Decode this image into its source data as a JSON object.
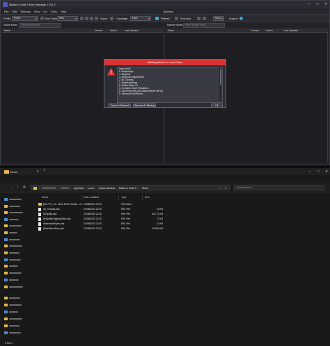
{
  "mod_manager": {
    "title": "Baldur's Gate 3 Mod Manager 1.0.6.4",
    "menu": [
      "File",
      "Edit",
      "Settings",
      "View",
      "Go",
      "Tools",
      "Help"
    ],
    "updates_label": "Updates",
    "toolbar": {
      "profile_label": "Profile",
      "profile_value": "Public",
      "modorder_label": "Mod Order",
      "modorder_value": "New",
      "export_label": "Export",
      "campaign_label": "Campaign",
      "campaign_value": "Main",
      "refresh_label": "Refresh",
      "shortcuts_label": "Shortcuts",
      "none_value": "None",
      "support_label": "Support"
    },
    "active_mods": {
      "label": "Active Mods",
      "filter_placeholder": "Filter Active Mods",
      "columns": [
        "Name",
        "Version",
        "Author",
        "Last Updated"
      ]
    },
    "inactive_mods": {
      "label": "Inactive Mods",
      "filter_placeholder": "Filter Inactive Mods",
      "columns": [
        "Name",
        "Version",
        "Author",
        "Last Updated"
      ]
    },
    "dialog": {
      "title": "Missing Mods in Load Order",
      "items": [
        "ImprovedUI",
        "5. BetterMaps",
        "4. 5eSpells",
        "3. 5eSpellsOriginalOther",
        "2. 5E_Tweaks",
        "1. BagsBagsBags",
        "6. BetterHotbar V2",
        "3. Complete Spell Rebalance",
        "5. Scorching Ray and Magic Missile Nerve)",
        "5. Valorance SeeBlinds"
      ],
      "copy_button": "Copy to Clipboard",
      "remove_button": "Remove All Missing",
      "ok_button": "OK"
    }
  },
  "explorer": {
    "tab_title": "Mods",
    "path": [
      "AppData",
      "Local",
      "Larian Studios",
      "Baldur's Gate 3",
      "Mods"
    ],
    "search_placeholder": "Search Mods",
    "columns": [
      "Name",
      "Date modified",
      "Type",
      "Size"
    ],
    "files": [
      {
        "name": "[BG-TT] - 01. Short Rest Tweaks - v2.0.0....",
        "date": "21/08/2023 22:20",
        "type": "File folder",
        "size": "",
        "folder": true
      },
      {
        "name": "05_Tweaks.pak",
        "date": "21/08/2023 22:20",
        "type": "PAK File",
        "size": "15 KB",
        "folder": false
      },
      {
        "name": "5eSpells.pak",
        "date": "21/08/2023 22:20",
        "type": "PAK File",
        "size": "60,772 KB",
        "folder": false
      },
      {
        "name": "5eSpellsOriginalOther.pak",
        "date": "21/08/2023 22:20",
        "type": "PAK File",
        "size": "17 KB",
        "folder": false
      },
      {
        "name": "AbberationEyes.pak",
        "date": "21/08/2023 22:20",
        "type": "PAK File",
        "size": "13 KB",
        "folder": false
      },
      {
        "name": "BetterBaseDice.pak",
        "date": "21/08/2023 22:20",
        "type": "PAK File",
        "size": "19,600 KB",
        "folder": false
      }
    ],
    "status": "6 items"
  }
}
